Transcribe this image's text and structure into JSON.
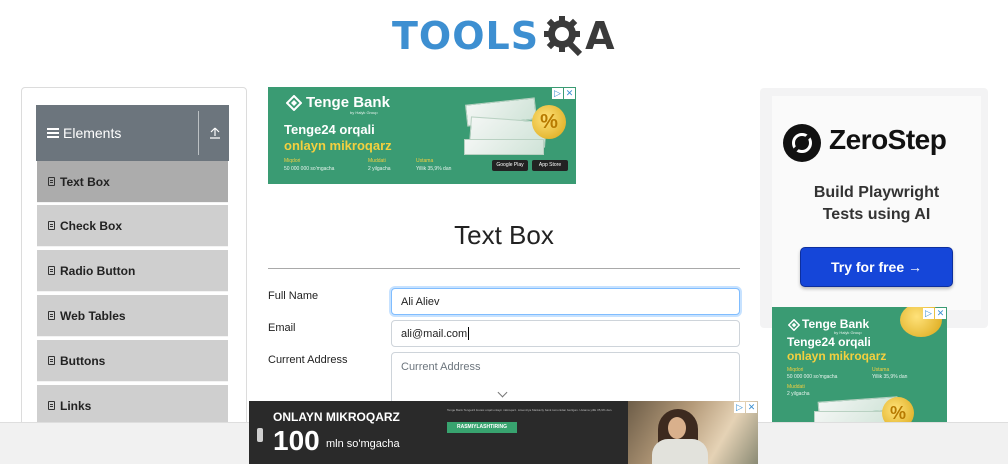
{
  "logo": {
    "left": "TOOLS",
    "right": "A"
  },
  "sidebar": {
    "group_title": "Elements",
    "items": [
      {
        "label": "Text Box",
        "active": true
      },
      {
        "label": "Check Box"
      },
      {
        "label": "Radio Button"
      },
      {
        "label": "Web Tables"
      },
      {
        "label": "Buttons"
      },
      {
        "label": "Links"
      }
    ]
  },
  "main": {
    "title": "Text Box",
    "fields": {
      "full_name_label": "Full Name",
      "full_name_value": "Ali Aliev",
      "email_label": "Email",
      "email_value": "ali@mail.com",
      "address_label": "Current Address",
      "address_placeholder": "Current Address"
    }
  },
  "ad_top": {
    "bank": "Tenge Bank",
    "bank_sub": "by Halyk Group",
    "line1": "Tenge24 orqali",
    "line2": "onlayn mikroqarz",
    "col1_head": "Miqdori",
    "col1_val": "50 000 000 so'mgacha",
    "col2_head": "Muddati",
    "col2_val": "2 yilgacha",
    "col3_head": "Ustama",
    "col3_val": "Yillik 35,9% dan",
    "store1": "Google Play",
    "store2": "App Store",
    "percent": "%"
  },
  "ad_zerostep": {
    "name": "ZeroStep",
    "tag1": "Build Playwright",
    "tag2": "Tests using AI",
    "cta": "Try for free →"
  },
  "ad_right_bank": {
    "bank": "Tenge Bank",
    "bank_sub": "by Halyk Group",
    "line1": "Tenge24 orqali",
    "line2": "onlayn mikroqarz",
    "col1_head": "Miqdori",
    "col1_val": "50 000 000 so'mgacha",
    "col2_head": "Ustama",
    "col2_val": "Yillik 35,9% dan",
    "col3_head": "Muddati",
    "col3_val": "2 yilgacha",
    "percent": "%"
  },
  "ad_bottom": {
    "headline": "ONLAYN MIKROQARZ",
    "amount": "100",
    "unit": "mln so'mgacha",
    "cta": "RASMIYLASHTIRING",
    "fine_print": "Tenge Bank Tenge24 ilovasi orqali onlayn mikroqarz. Litsenziya Markaziy bank tomonidan berilgan. Ustama yillik 35,9% dan."
  },
  "ad_controls": {
    "info": "▷",
    "close": "✕"
  }
}
